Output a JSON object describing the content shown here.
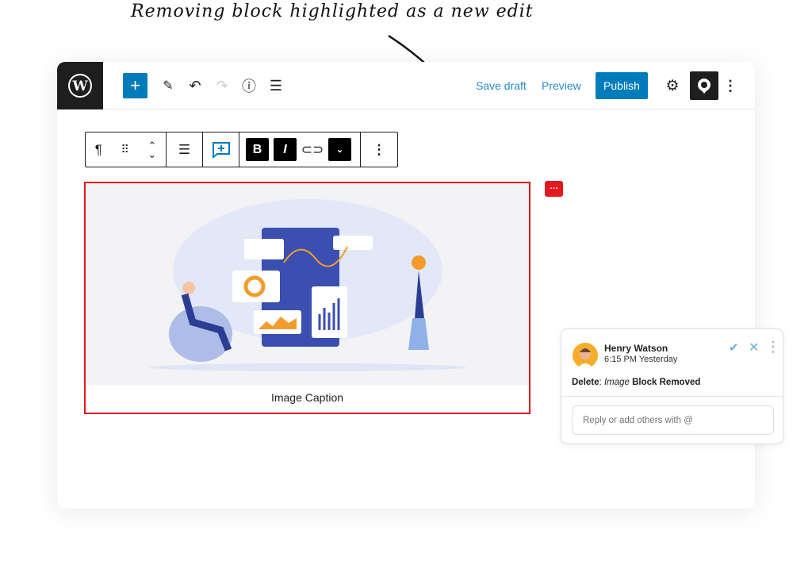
{
  "annotation": "Removing block highlighted as a new edit",
  "header": {
    "save_draft": "Save draft",
    "preview": "Preview",
    "publish": "Publish",
    "add_icon": "plus-icon"
  },
  "toolbar": {
    "paragraph": "¶",
    "bold": "B",
    "italic": "I"
  },
  "block": {
    "caption": "Image Caption",
    "highlight_color": "#e3191f"
  },
  "comment": {
    "author": "Henry Watson",
    "time": "6:15 PM Yesterday",
    "action": "Delete",
    "colon": ":",
    "type": "Image",
    "status": "Block Removed",
    "reply_placeholder": "Reply or add others with @"
  },
  "colors": {
    "accent": "#007cba",
    "highlight": "#e3191f"
  }
}
